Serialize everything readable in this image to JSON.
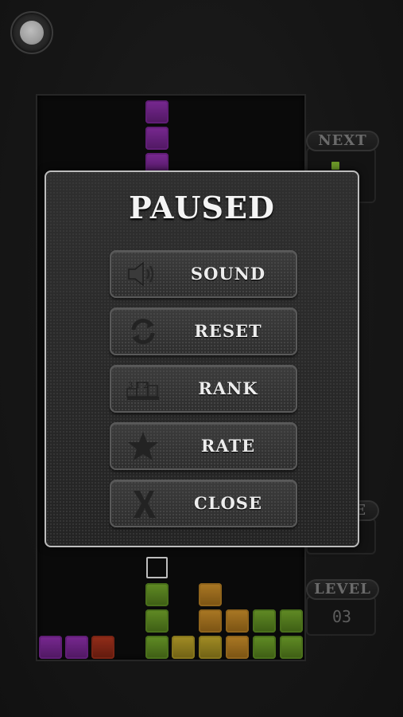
{
  "modal": {
    "title": "PAUSED",
    "buttons": [
      {
        "label": "SOUND",
        "icon": "speaker-icon"
      },
      {
        "label": "RESET",
        "icon": "refresh-icon"
      },
      {
        "label": "RANK",
        "icon": "podium-icon"
      },
      {
        "label": "RATE",
        "icon": "star-icon"
      },
      {
        "label": "CLOSE",
        "icon": "close-icon"
      }
    ],
    "rank_icon_digits": "3 1 2"
  },
  "sidebar": {
    "next_label": "NEXT",
    "score_label_visible_fragment": "E",
    "level_label": "LEVEL",
    "level_value": "03"
  },
  "colors": {
    "purple": "#7a2896",
    "green": "#5f8c24",
    "yellow": "#a48f22",
    "orange": "#b27a22",
    "red": "#952c18",
    "modal_border": "#bdbdbd",
    "title_text": "#f4f4f4"
  }
}
